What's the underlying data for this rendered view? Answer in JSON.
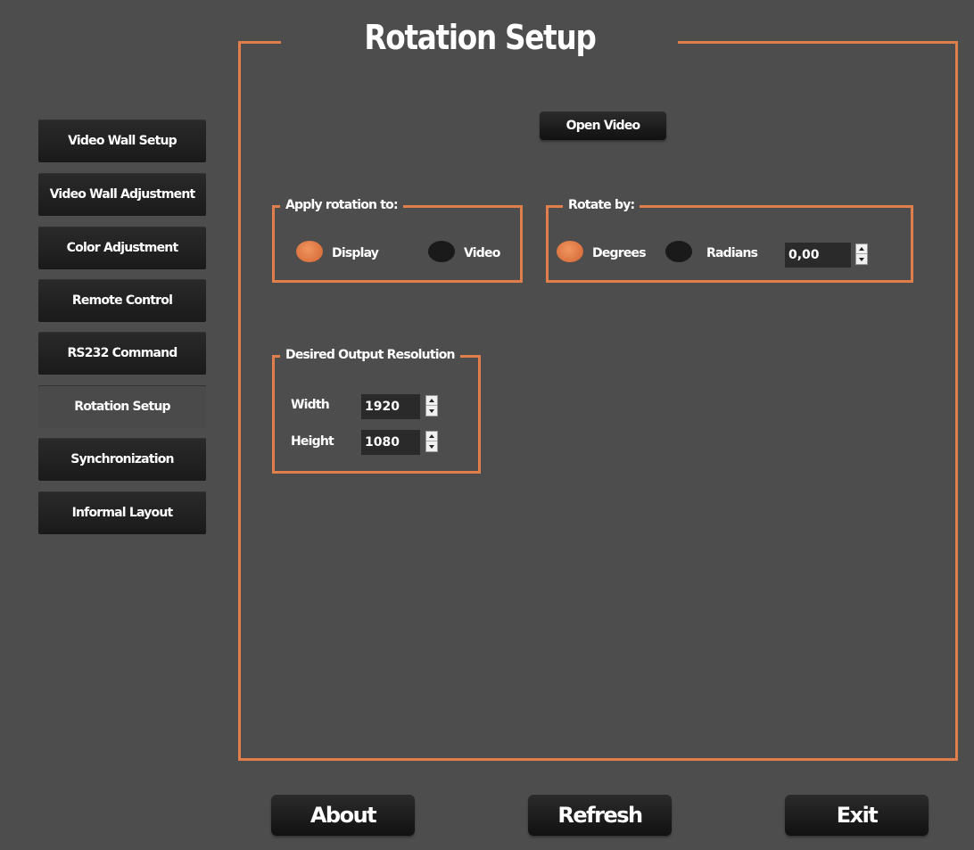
{
  "title": "Rotation Setup",
  "sidebar": {
    "items": [
      {
        "label": "Video Wall Setup"
      },
      {
        "label": "Video Wall Adjustment"
      },
      {
        "label": "Color Adjustment"
      },
      {
        "label": "Remote Control"
      },
      {
        "label": "RS232 Command"
      },
      {
        "label": "Rotation Setup",
        "active": true
      },
      {
        "label": "Synchronization"
      },
      {
        "label": "Informal Layout"
      }
    ]
  },
  "open_video_label": "Open Video",
  "apply_rotation": {
    "title": "Apply rotation to:",
    "options": [
      "Display",
      "Video"
    ],
    "selected": "Display"
  },
  "rotate_by": {
    "title": "Rotate by:",
    "options": [
      "Degrees",
      "Radians"
    ],
    "selected": "Degrees",
    "value": "0,00"
  },
  "resolution": {
    "title": "Desired Output Resolution",
    "width_label": "Width",
    "width_value": "1920",
    "height_label": "Height",
    "height_value": "1080"
  },
  "footer": {
    "about": "About",
    "refresh": "Refresh",
    "exit": "Exit"
  },
  "colors": {
    "accent": "#e07f4c",
    "background": "#4d4d4d",
    "button": "#1a1a1a"
  }
}
